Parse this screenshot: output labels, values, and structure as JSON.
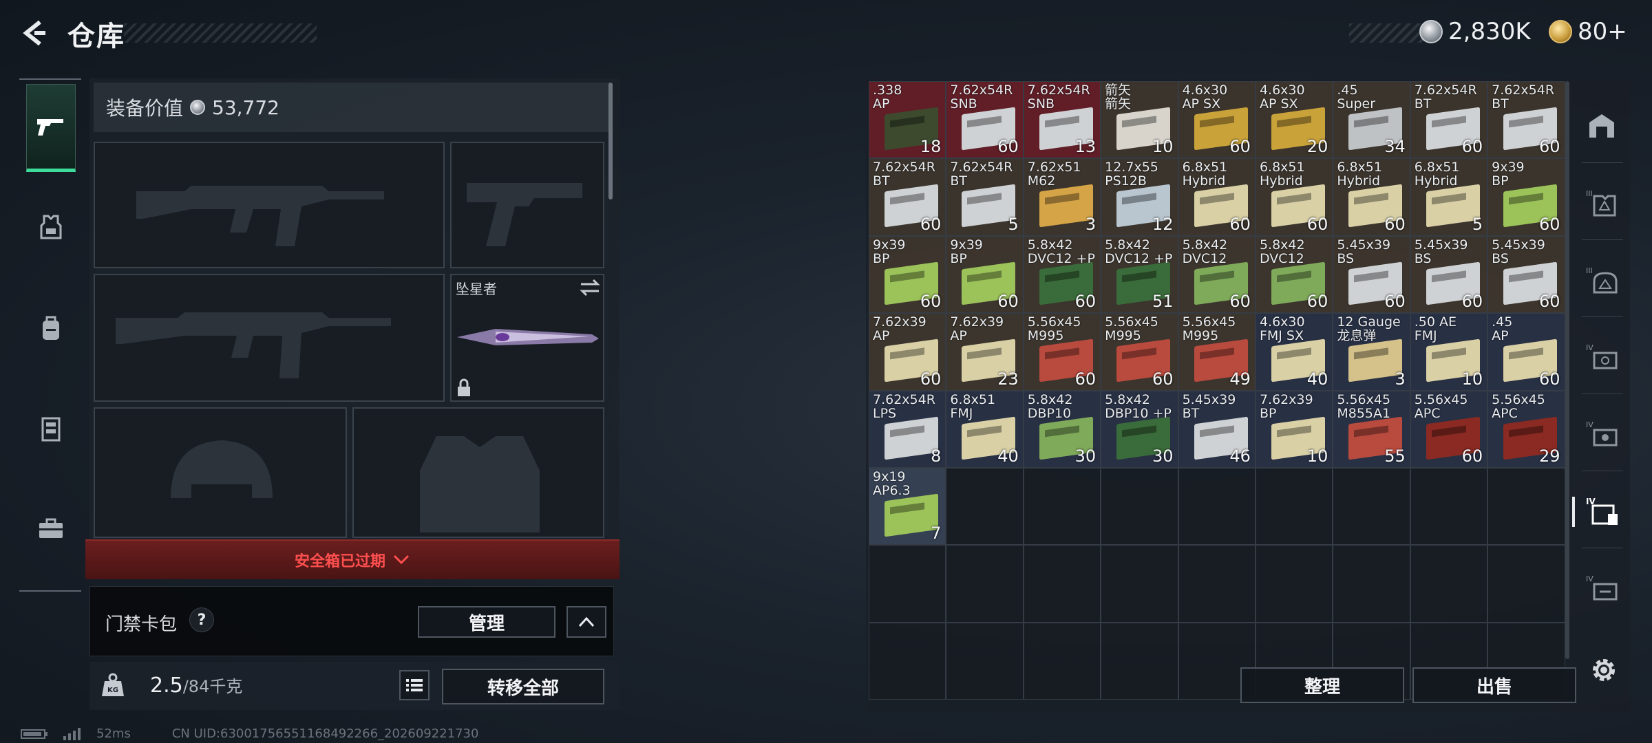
{
  "header": {
    "title": "仓库",
    "silver_amount": "2,830K",
    "gold_amount": "80+"
  },
  "left_nav": {
    "items": [
      "weapon",
      "armor-vest",
      "backpack",
      "rig",
      "briefcase"
    ]
  },
  "equipment": {
    "value_label": "装备价值",
    "value": "53,772",
    "melee_name": "坠星者",
    "safe_box_label": "安全箱已过期"
  },
  "card_bag": {
    "label": "门禁卡包",
    "help": "?",
    "manage": "管理"
  },
  "weight": {
    "current": "2.5",
    "max_unit": "/84千克",
    "transfer_all": "转移全部"
  },
  "status": {
    "ping": "52ms",
    "uid": "CN UID:6300175655116849​2266_202609221730"
  },
  "storage": {
    "items": [
      {
        "name": ".338\nAP",
        "count": "18",
        "bg": "red",
        "box": "#3d4a2e"
      },
      {
        "name": "7.62x54R\nSNB",
        "count": "60",
        "bg": "red",
        "box": "#cfd2d4"
      },
      {
        "name": "7.62x54R\nSNB",
        "count": "13",
        "bg": "red",
        "box": "#cfd2d4"
      },
      {
        "name": "箭矢\n箭矢",
        "count": "10",
        "bg": "filled",
        "box": "#d8d4cc"
      },
      {
        "name": "4.6x30\nAP SX",
        "count": "60",
        "bg": "filled",
        "box": "#c9a23a"
      },
      {
        "name": "4.6x30\nAP SX",
        "count": "20",
        "bg": "filled",
        "box": "#c9a23a"
      },
      {
        "name": ".45\nSuper",
        "count": "34",
        "bg": "filled",
        "box": "#bfc2c5"
      },
      {
        "name": "7.62x54R\nBT",
        "count": "60",
        "bg": "filled",
        "box": "#cfd2d4"
      },
      {
        "name": "7.62x54R\nBT",
        "count": "60",
        "bg": "filled",
        "box": "#cfd2d4"
      },
      {
        "name": "7.62x54R\nBT",
        "count": "60",
        "bg": "filled",
        "box": "#cfd2d4"
      },
      {
        "name": "7.62x54R\nBT",
        "count": "5",
        "bg": "filled",
        "box": "#cfd2d4"
      },
      {
        "name": "7.62x51\nM62",
        "count": "3",
        "bg": "filled",
        "box": "#d4a447"
      },
      {
        "name": "12.7x55\nPS12B",
        "count": "12",
        "bg": "filled",
        "box": "#b9c6cf"
      },
      {
        "name": "6.8x51\nHybrid",
        "count": "60",
        "bg": "filled",
        "box": "#d9d0a6"
      },
      {
        "name": "6.8x51\nHybrid",
        "count": "60",
        "bg": "filled",
        "box": "#d9d0a6"
      },
      {
        "name": "6.8x51\nHybrid",
        "count": "60",
        "bg": "filled",
        "box": "#d9d0a6"
      },
      {
        "name": "6.8x51\nHybrid",
        "count": "5",
        "bg": "filled",
        "box": "#d9d0a6"
      },
      {
        "name": "9x39\nBP",
        "count": "60",
        "bg": "filled",
        "box": "#9cc25a"
      },
      {
        "name": "9x39\nBP",
        "count": "60",
        "bg": "filled",
        "box": "#9cc25a"
      },
      {
        "name": "9x39\nBP",
        "count": "60",
        "bg": "filled",
        "box": "#9cc25a"
      },
      {
        "name": "5.8x42\nDVC12 +P",
        "count": "60",
        "bg": "filled",
        "box": "#3a6b3a"
      },
      {
        "name": "5.8x42\nDVC12 +P",
        "count": "51",
        "bg": "filled",
        "box": "#3a6b3a"
      },
      {
        "name": "5.8x42\nDVC12",
        "count": "60",
        "bg": "filled",
        "box": "#7faa5a"
      },
      {
        "name": "5.8x42\nDVC12",
        "count": "60",
        "bg": "filled",
        "box": "#7faa5a"
      },
      {
        "name": "5.45x39\nBS",
        "count": "60",
        "bg": "filled",
        "box": "#cfd2d4"
      },
      {
        "name": "5.45x39\nBS",
        "count": "60",
        "bg": "filled",
        "box": "#cfd2d4"
      },
      {
        "name": "5.45x39\nBS",
        "count": "60",
        "bg": "filled",
        "box": "#cfd2d4"
      },
      {
        "name": "7.62x39\nAP",
        "count": "60",
        "bg": "filled",
        "box": "#d9d0a6"
      },
      {
        "name": "7.62x39\nAP",
        "count": "23",
        "bg": "filled",
        "box": "#d9d0a6"
      },
      {
        "name": "5.56x45\nM995",
        "count": "60",
        "bg": "filled",
        "box": "#b94a3e"
      },
      {
        "name": "5.56x45\nM995",
        "count": "60",
        "bg": "filled",
        "box": "#b94a3e"
      },
      {
        "name": "5.56x45\nM995",
        "count": "49",
        "bg": "filled",
        "box": "#b94a3e"
      },
      {
        "name": "4.6x30\nFMJ SX",
        "count": "40",
        "bg": "blue",
        "box": "#d9d0a6"
      },
      {
        "name": "12 Gauge\n龙息弹",
        "count": "3",
        "bg": "blue",
        "box": "#d4c28a"
      },
      {
        "name": ".50 AE\nFMJ",
        "count": "10",
        "bg": "blue",
        "box": "#d9d0a6"
      },
      {
        "name": ".45\nAP",
        "count": "60",
        "bg": "blue",
        "box": "#d9d0a6"
      },
      {
        "name": "7.62x54R\nLPS",
        "count": "8",
        "bg": "blue",
        "box": "#cfd2d4"
      },
      {
        "name": "6.8x51\nFMJ",
        "count": "40",
        "bg": "blue",
        "box": "#d9d0a6"
      },
      {
        "name": "5.8x42\nDBP10",
        "count": "30",
        "bg": "blue",
        "box": "#7faa5a"
      },
      {
        "name": "5.8x42\nDBP10 +P",
        "count": "30",
        "bg": "blue",
        "box": "#3a6b3a"
      },
      {
        "name": "5.45x39\nBT",
        "count": "46",
        "bg": "blue",
        "box": "#cfd2d4"
      },
      {
        "name": "7.62x39\nBP",
        "count": "10",
        "bg": "blue",
        "box": "#d9d0a6"
      },
      {
        "name": "5.56x45\nM855A1",
        "count": "55",
        "bg": "blue",
        "box": "#b94a3e"
      },
      {
        "name": "5.56x45\nAPC",
        "count": "60",
        "bg": "blue",
        "box": "#8a2a22"
      },
      {
        "name": "5.56x45\nAPC",
        "count": "29",
        "bg": "blue",
        "box": "#8a2a22"
      },
      {
        "name": "9x19\nAP6.3",
        "count": "7",
        "bg": "lightblue",
        "box": "#9cc25a"
      }
    ],
    "sort": "整理",
    "sell": "出售"
  },
  "right_categories": {
    "items": [
      "all",
      "level-III-armor",
      "level-III-helmet",
      "level-IV-armor",
      "level-IV-rig",
      "level-IV-container",
      "level-IV-case"
    ]
  }
}
